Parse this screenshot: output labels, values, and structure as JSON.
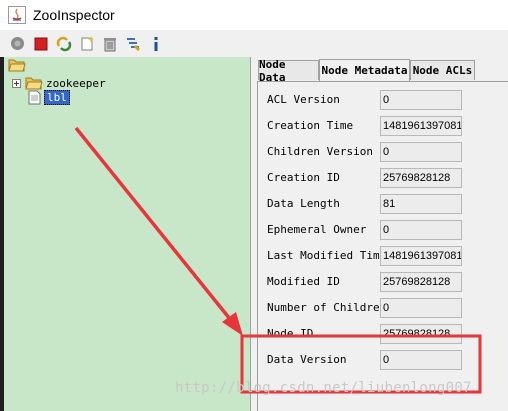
{
  "window": {
    "title": "ZooInspector"
  },
  "toolbar": {
    "buttons": [
      {
        "name": "connect-icon",
        "color": "#8a8a8a"
      },
      {
        "name": "disconnect-icon",
        "color": "#d42020"
      },
      {
        "name": "refresh-icon",
        "color": "#d8a020"
      },
      {
        "name": "add-node-icon",
        "color": "#e0c040"
      },
      {
        "name": "delete-node-icon",
        "color": "#909090"
      },
      {
        "name": "node-viewers-icon",
        "color": "#4070c0"
      },
      {
        "name": "about-icon",
        "color": "#1a4fa0"
      }
    ]
  },
  "tree": {
    "root_icon": "folder-open-icon",
    "items": [
      {
        "label": "zookeeper",
        "type": "folder"
      },
      {
        "label": "lbl",
        "type": "file",
        "selected": true
      }
    ]
  },
  "tabs": [
    {
      "label": "Node Data",
      "active": false
    },
    {
      "label": "Node Metadata",
      "active": true
    },
    {
      "label": "Node ACLs",
      "active": false
    }
  ],
  "metadata": [
    {
      "label": "ACL Version",
      "value": "0"
    },
    {
      "label": "Creation Time",
      "value": "1481961397081"
    },
    {
      "label": "Children Version",
      "value": "0"
    },
    {
      "label": "Creation ID",
      "value": "25769828128"
    },
    {
      "label": "Data Length",
      "value": "81"
    },
    {
      "label": "Ephemeral Owner",
      "value": "0"
    },
    {
      "label": "Last Modified Time",
      "value": "1481961397081"
    },
    {
      "label": "Modified ID",
      "value": "25769828128"
    },
    {
      "label": "Number of Children",
      "value": "0"
    },
    {
      "label": "Node ID",
      "value": "25769828128"
    },
    {
      "label": "Data Version",
      "value": "0"
    }
  ],
  "annotation": {
    "color": "#e8353a"
  },
  "watermark": "http://blog.csdn.net/liubenlong007"
}
